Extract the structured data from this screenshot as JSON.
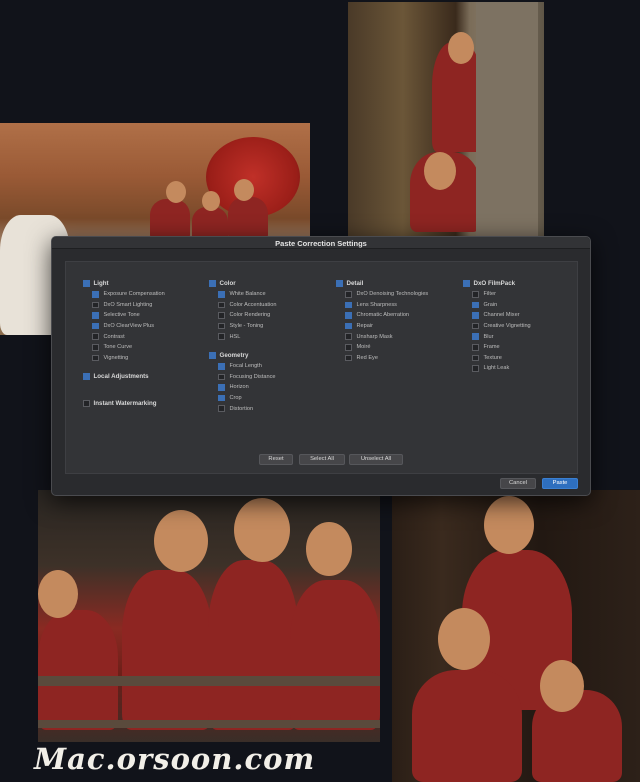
{
  "dialog": {
    "title": "Paste Correction Settings",
    "columns": [
      {
        "groups": [
          {
            "label": "Light",
            "checked": true,
            "items": [
              {
                "label": "Exposure Compensation",
                "checked": true
              },
              {
                "label": "DxO Smart Lighting",
                "checked": false
              },
              {
                "label": "Selective Tone",
                "checked": true
              },
              {
                "label": "DxO ClearView Plus",
                "checked": true
              },
              {
                "label": "Contrast",
                "checked": false
              },
              {
                "label": "Tone Curve",
                "checked": false
              },
              {
                "label": "Vignetting",
                "checked": false
              }
            ]
          },
          {
            "label": "Local Adjustments",
            "checked": true,
            "items": []
          },
          {
            "label": "Instant Watermarking",
            "checked": false,
            "items": []
          }
        ]
      },
      {
        "groups": [
          {
            "label": "Color",
            "checked": true,
            "items": [
              {
                "label": "White Balance",
                "checked": true
              },
              {
                "label": "Color Accentuation",
                "checked": false
              },
              {
                "label": "Color Rendering",
                "checked": false
              },
              {
                "label": "Style - Toning",
                "checked": false
              },
              {
                "label": "HSL",
                "checked": false
              }
            ]
          },
          {
            "label": "Geometry",
            "checked": true,
            "items": [
              {
                "label": "Focal Length",
                "checked": true
              },
              {
                "label": "Focusing Distance",
                "checked": false
              },
              {
                "label": "Horizon",
                "checked": true
              },
              {
                "label": "Crop",
                "checked": true
              },
              {
                "label": "Distortion",
                "checked": false
              }
            ]
          }
        ]
      },
      {
        "groups": [
          {
            "label": "Detail",
            "checked": true,
            "items": [
              {
                "label": "DxO Denoising Technologies",
                "checked": false
              },
              {
                "label": "Lens Sharpness",
                "checked": true
              },
              {
                "label": "Chromatic Aberration",
                "checked": true
              },
              {
                "label": "Repair",
                "checked": true
              },
              {
                "label": "Unsharp Mask",
                "checked": false
              },
              {
                "label": "Moiré",
                "checked": false
              },
              {
                "label": "Red Eye",
                "checked": false
              }
            ]
          }
        ]
      },
      {
        "groups": [
          {
            "label": "DxO FilmPack",
            "checked": true,
            "items": [
              {
                "label": "Filter",
                "checked": false
              },
              {
                "label": "Grain",
                "checked": true
              },
              {
                "label": "Channel Mixer",
                "checked": true
              },
              {
                "label": "Creative Vignetting",
                "checked": false
              },
              {
                "label": "Blur",
                "checked": true
              },
              {
                "label": "Frame",
                "checked": false
              },
              {
                "label": "Texture",
                "checked": false
              },
              {
                "label": "Light Leak",
                "checked": false
              }
            ]
          }
        ]
      }
    ],
    "buttons": {
      "reset": "Reset",
      "select_all": "Select All",
      "unselect_all": "Unselect All",
      "cancel": "Cancel",
      "paste": "Paste"
    }
  },
  "watermark": "Mac.orsoon.com",
  "colors": {
    "accent": "#2e6fbf",
    "checkbox_on": "#3b6fb5",
    "background": "#11131a"
  }
}
